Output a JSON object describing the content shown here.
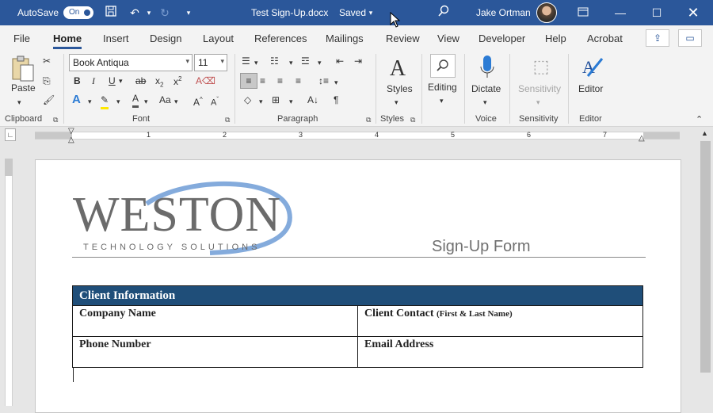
{
  "titlebar": {
    "autosave_label": "AutoSave",
    "autosave_state": "On",
    "document_title": "Test Sign-Up.docx",
    "save_status": "Saved",
    "user_name": "Jake Ortman"
  },
  "tabs": [
    "File",
    "Home",
    "Insert",
    "Design",
    "Layout",
    "References",
    "Mailings",
    "Review",
    "View",
    "Developer",
    "Help",
    "Acrobat"
  ],
  "ribbon": {
    "clipboard": {
      "paste": "Paste",
      "label": "Clipboard"
    },
    "font": {
      "name": "Book Antiqua",
      "size": "11",
      "label": "Font"
    },
    "paragraph": {
      "label": "Paragraph"
    },
    "styles": {
      "button": "Styles",
      "label": "Styles"
    },
    "editing": {
      "button": "Editing"
    },
    "voice": {
      "button": "Dictate",
      "label": "Voice"
    },
    "sensitivity": {
      "button": "Sensitivity",
      "label": "Sensitivity"
    },
    "editor": {
      "button": "Editor",
      "label": "Editor"
    }
  },
  "ruler": {
    "numbers": [
      "1",
      "2",
      "3",
      "4",
      "5",
      "6",
      "7"
    ]
  },
  "document": {
    "logo_word": "WESTON",
    "logo_sub": "TECHNOLOGY SOLUTIONS",
    "form_title": "Sign-Up Form",
    "table": {
      "header": "Client Information",
      "company_name": "Company Name",
      "client_contact": "Client Contact",
      "client_contact_note": "(First & Last Name)",
      "phone_number": "Phone Number",
      "email_address": "Email Address"
    }
  },
  "colors": {
    "accent": "#2b579a",
    "table_header": "#1f4e79"
  }
}
